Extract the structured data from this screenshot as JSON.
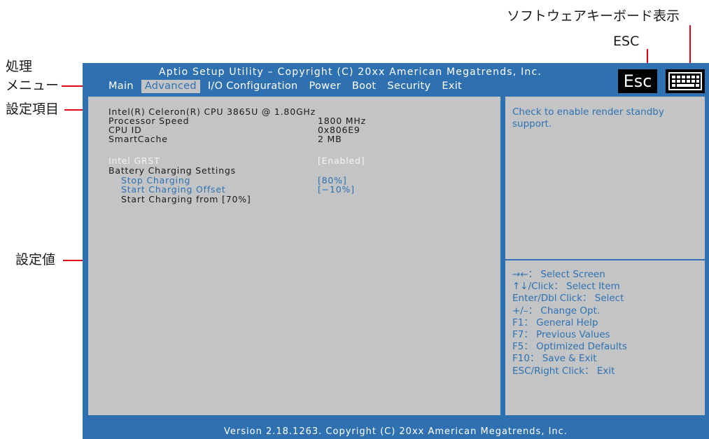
{
  "annotations": {
    "processing_menu_line1": "処理",
    "processing_menu_line2": "メニュー",
    "setting_items": "設定項目",
    "setting_value": "設定値",
    "esc": "ESC",
    "software_keyboard": "ソフトウェアキーボード表示"
  },
  "header": {
    "title": "Aptio Setup Utility – Copyright (C) 20xx American Megatrends, Inc.",
    "esc_icon_label": "Esc"
  },
  "menu": {
    "items": [
      "Main",
      "Advanced",
      "I/O Configuration",
      "Power",
      "Boot",
      "Security",
      "Exit"
    ],
    "active": "Advanced"
  },
  "settings": {
    "cpu_name": "Intel(R) Celeron(R) CPU 3865U @ 1.80GHz",
    "rows": [
      {
        "label": "Processor Speed",
        "value": "1800 MHz"
      },
      {
        "label": "CPU ID",
        "value": "0x806E9"
      },
      {
        "label": "SmartCache",
        "value": "2 MB"
      }
    ],
    "intel_grst": {
      "label": "Intel GRST",
      "value": "[Enabled]"
    },
    "battery_section": "Battery Charging Settings",
    "stop_charging": {
      "label": "Stop Charging",
      "value": "[80%]"
    },
    "start_charging_offset": {
      "label": "Start Charging Offset",
      "value": "[−10%]"
    },
    "start_charging_from": "Start Charging from [70%]"
  },
  "help": {
    "text": "Check to enable render standby support."
  },
  "keys": [
    "→←： Select Screen",
    "↑↓/Click： Select Item",
    "Enter/Dbl Click： Select",
    "+/–： Change Opt.",
    "F1： General Help",
    "F7： Previous Values",
    "F5： Optimized Defaults",
    "F10： Save & Exit",
    "ESC/Right Click： Exit"
  ],
  "footer": {
    "text": "Version 2.18.1263. Copyright (C) 20xx American Megatrends, Inc."
  },
  "colors": {
    "bios_blue": "#2f71b0",
    "panel_gray": "#c3c4c6",
    "annotation_red": "#e3001b"
  }
}
